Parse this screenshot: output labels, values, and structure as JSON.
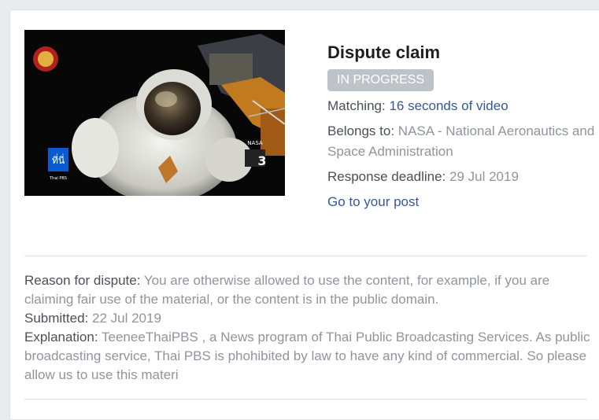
{
  "claim": {
    "title": "Dispute claim",
    "status": "IN PROGRESS",
    "matching_label": "Matching:",
    "matching_value": "16 seconds of video",
    "belongs_label": "Belongs to:",
    "belongs_value": "NASA - National Aeronautics and Space Administration",
    "deadline_label": "Response deadline:",
    "deadline_value": "29 Jul 2019",
    "post_link": "Go to your post"
  },
  "details": {
    "reason_label": "Reason for dispute:",
    "reason_value": "You are otherwise allowed to use the content, for example, if you are claiming fair use of the material, or the content is in the public domain.",
    "submitted_label": "Submitted:",
    "submitted_value": "22 Jul 2019",
    "explanation_label": "Explanation:",
    "explanation_value": "TeeneeThaiPBS , a News program of Thai Public Broadcasting Services. As public broadcasting service, Thai PBS is phohibited by law to have any kind of commercial. So please allow us to use this materi"
  },
  "video": {
    "logo_text": "ที่นี่",
    "logo_sub": "Thai PBS",
    "channel_number": "3",
    "channel_text": "NASA"
  },
  "colors": {
    "link": "#365899",
    "badge": "#bec3c9",
    "muted": "#90949c"
  }
}
